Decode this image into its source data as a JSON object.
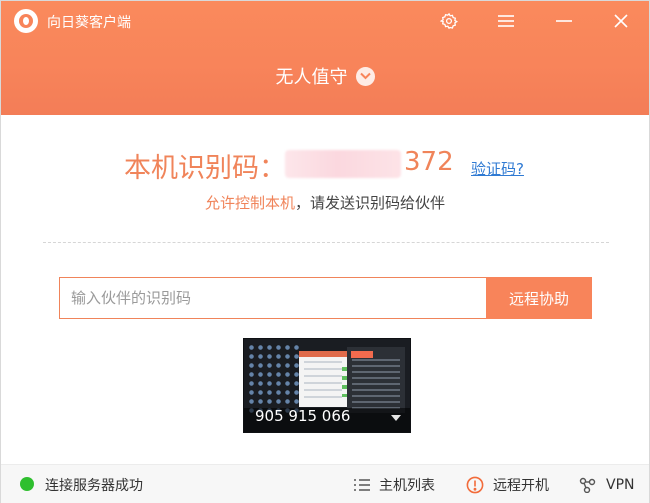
{
  "app": {
    "title": "向日葵客户端"
  },
  "titlebar": {
    "icons": [
      "gear-icon",
      "menu-icon",
      "minimize-icon",
      "close-icon"
    ]
  },
  "header": {
    "mode_label": "无人值守"
  },
  "identity": {
    "label": "本机识别码：",
    "visible_digits": "372",
    "verify_link": "验证码?"
  },
  "hint": {
    "highlight": "允许控制本机",
    "rest": "，请发送识别码给伙伴"
  },
  "remote": {
    "input_placeholder": "输入伙伴的识别码",
    "input_value": "",
    "assist_button": "远程协助"
  },
  "preview": {
    "code": "905 915 066"
  },
  "status": {
    "connection": "连接服务器成功",
    "host_list": "主机列表",
    "remote_boot": "远程开机",
    "vpn": "VPN"
  },
  "colors": {
    "accent": "#f8845a",
    "link": "#2f7ad3",
    "online": "#2fbf2f"
  }
}
